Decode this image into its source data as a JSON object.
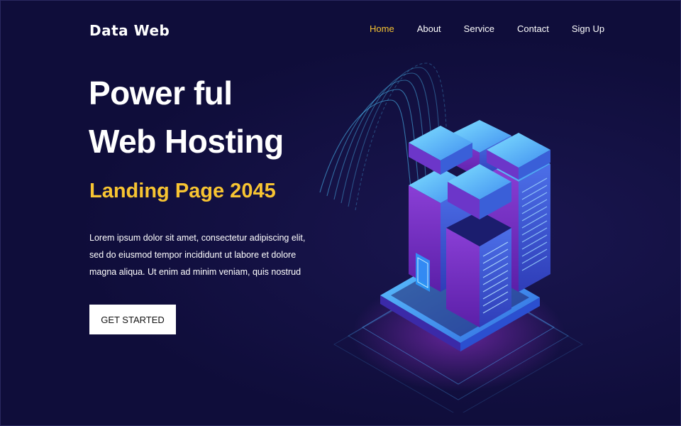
{
  "brand": {
    "logo_text": "Data Web"
  },
  "nav": {
    "items": [
      {
        "label": "Home",
        "active": true
      },
      {
        "label": "About"
      },
      {
        "label": "Service"
      },
      {
        "label": "Contact"
      },
      {
        "label": "Sign Up"
      }
    ]
  },
  "hero": {
    "title_line1": "Power ful",
    "title_line2": "Web Hosting",
    "subtitle": "Landing Page 2045",
    "description_lines": [
      "Lorem ipsum dolor sit amet, consectetur adipiscing elit,",
      "sed do eiusmod tempor incididunt ut labore et dolore",
      "magna aliqua. Ut enim ad minim veniam, quis nostrud"
    ],
    "cta_label": "GET STARTED"
  },
  "colors": {
    "background": "#0f0d3a",
    "accent": "#f7c432",
    "text": "#ffffff",
    "button_bg": "#ffffff"
  },
  "illustration": {
    "name": "isometric-server-racks"
  }
}
